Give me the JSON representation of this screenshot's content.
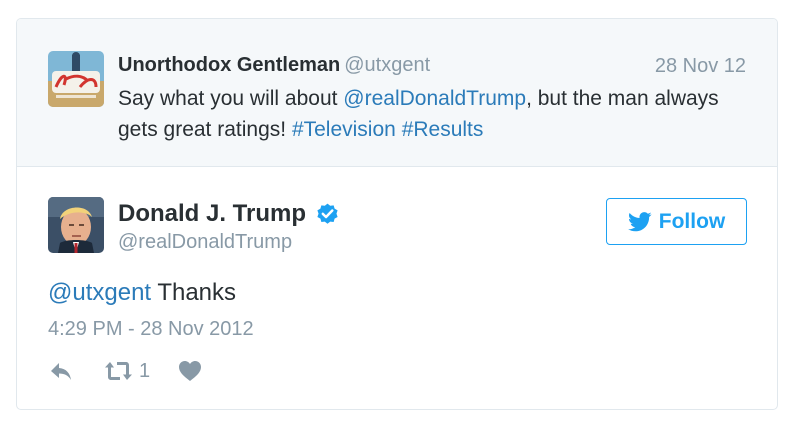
{
  "parent_tweet": {
    "name": "Unorthodox Gentleman",
    "handle": "@utxgent",
    "date": "28 Nov 12",
    "text_before": "Say what you will about ",
    "mention": "@realDonaldTrump",
    "text_middle": ", but the man always gets great ratings! ",
    "hashtag_1": "#Television",
    "hashtag_2": "#Results",
    "avatar_icon": "profile-avatar-icon"
  },
  "tweet": {
    "name": "Donald J. Trump",
    "handle": "@realDonaldTrump",
    "verified_icon": "verified-badge-icon",
    "follow_label": "Follow",
    "mention": "@utxgent",
    "text": " Thanks",
    "timestamp": "4:29 PM - 28 Nov 2012",
    "retweet_count": "1",
    "avatar_icon": "profile-avatar-icon"
  },
  "actions": {
    "reply_icon": "reply-icon",
    "retweet_icon": "retweet-icon",
    "like_icon": "heart-icon"
  },
  "colors": {
    "link": "#2b7bb9",
    "twitter_blue": "#1da1f2",
    "muted": "#8899a6",
    "parent_bg": "#f5f8fa",
    "border": "#e1e8ed"
  }
}
